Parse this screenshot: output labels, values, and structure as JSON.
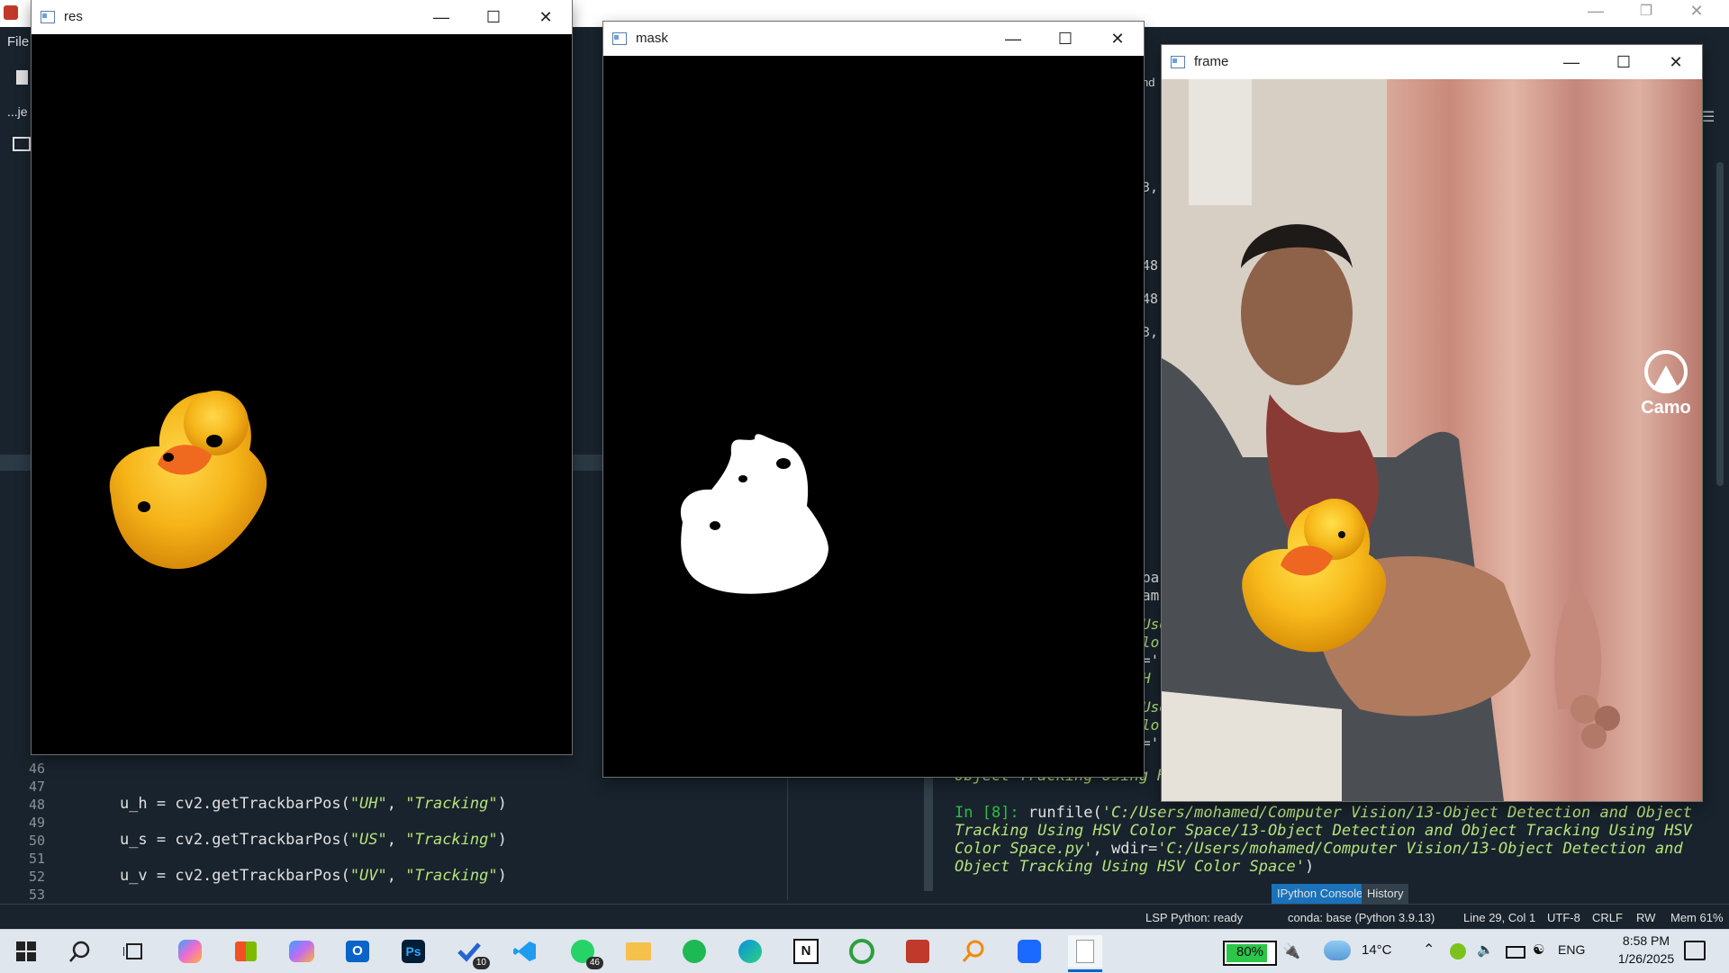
{
  "spyder": {
    "menu_file": "File",
    "breadcrumb": "...je",
    "partial_tab": "nd",
    "side_numbers": [
      "3,",
      "48",
      "48",
      "3,"
    ],
    "console_clip": [
      "ba",
      "am",
      "Use",
      "lo",
      "='",
      "H",
      "Use",
      "lo",
      "='"
    ],
    "code_lines": [
      {
        "no": "46",
        "text": ""
      },
      {
        "no": "47",
        "text": ""
      },
      {
        "no": "48",
        "pre": "    u_h = cv2.getTrackbarPos(",
        "a": "\"UH\"",
        "mid": ", ",
        "b": "\"Tracking\"",
        "post": ")"
      },
      {
        "no": "49",
        "text": ""
      },
      {
        "no": "50",
        "pre": "    u_s = cv2.getTrackbarPos(",
        "a": "\"US\"",
        "mid": ", ",
        "b": "\"Tracking\"",
        "post": ")"
      },
      {
        "no": "51",
        "text": ""
      },
      {
        "no": "52",
        "pre": "    u_v = cv2.getTrackbarPos(",
        "a": "\"UV\"",
        "mid": ", ",
        "b": "\"Tracking\"",
        "post": ")"
      },
      {
        "no": "53",
        "text": ""
      }
    ],
    "console": {
      "clipped_line": "Object Tracking Using H",
      "prompt": "In [8]:",
      "cmd": " runfile(",
      "path1": "'C:/Users/mohamed/Computer Vision/13-Object Detection and Object",
      "path2": "Tracking Using HSV Color Space/13-Object Detection and Object Tracking Using HSV",
      "path3": "Color Space.py'",
      "wdir_label": ", wdir=",
      "path4": "'C:/Users/mohamed/Computer Vision/13-Object Detection and",
      "path5": "Object Tracking Using HSV Color Space'",
      "close": ")"
    },
    "tabs": [
      "IPython Console",
      "History"
    ],
    "status": {
      "lsp": "LSP Python: ready",
      "conda": "conda: base (Python 3.9.13)",
      "position": "Line 29, Col 1",
      "encoding": "UTF-8",
      "eol": "CRLF",
      "rw": "RW",
      "mem": "Mem 61%"
    }
  },
  "windows": {
    "res": {
      "title": "res"
    },
    "mask": {
      "title": "mask"
    },
    "frame": {
      "title": "frame",
      "overlay_label": "Camo"
    }
  },
  "taskbar": {
    "badges": {
      "todo": "10",
      "whatsapp": "46"
    },
    "battery": "80%",
    "temperature": "14°C",
    "language": "ENG",
    "time": "8:58 PM",
    "date": "1/26/2025"
  }
}
